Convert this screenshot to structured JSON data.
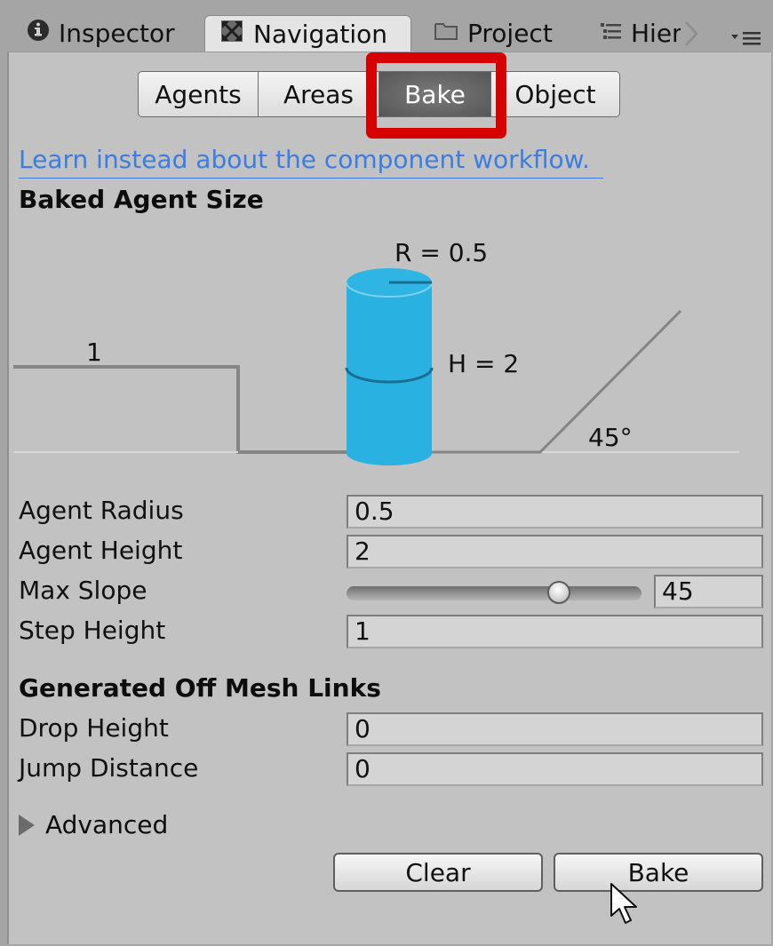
{
  "tabs": [
    {
      "label": "Inspector",
      "icon": "info-icon",
      "active": false
    },
    {
      "label": "Navigation",
      "icon": "navigation-icon",
      "active": true
    },
    {
      "label": "Project",
      "icon": "folder-icon",
      "active": false
    },
    {
      "label": "Hier",
      "icon": "hierarchy-icon",
      "active": false
    }
  ],
  "tab_overflow_icon": "chevron-right-icon",
  "tab_menu_icon": "menu-icon",
  "segments": [
    {
      "label": "Agents",
      "active": false
    },
    {
      "label": "Areas",
      "active": false
    },
    {
      "label": "Bake",
      "active": true
    },
    {
      "label": "Object",
      "active": false
    }
  ],
  "highlight_color": "#d60000",
  "link_text": "Learn instead about the component workflow.",
  "link_color": "#3b7de0",
  "baked_agent_size": {
    "header": "Baked Agent Size",
    "diagram": {
      "radius_label": "R = 0.5",
      "height_label": "H = 2",
      "step_label": "1",
      "slope_label": "45°",
      "agent_color": "#29b2e1"
    },
    "fields": [
      {
        "label": "Agent Radius",
        "value": "0.5"
      },
      {
        "label": "Agent Height",
        "value": "2"
      },
      {
        "label": "Max Slope",
        "value": "45",
        "slider_fraction": 0.74
      },
      {
        "label": "Step Height",
        "value": "1"
      }
    ]
  },
  "off_mesh_links": {
    "header": "Generated Off Mesh Links",
    "fields": [
      {
        "label": "Drop Height",
        "value": "0"
      },
      {
        "label": "Jump Distance",
        "value": "0"
      }
    ]
  },
  "advanced_label": "Advanced",
  "buttons": {
    "clear": "Clear",
    "bake": "Bake"
  }
}
